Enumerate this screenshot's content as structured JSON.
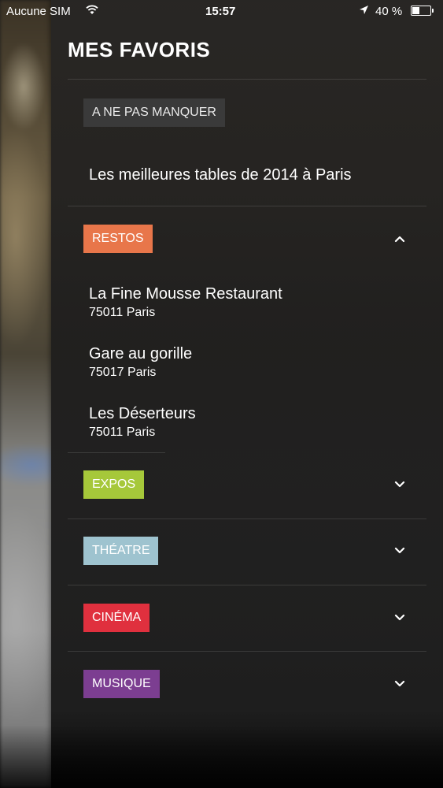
{
  "status_bar": {
    "carrier": "Aucune SIM",
    "time": "15:57",
    "battery": "40 %",
    "battery_level": 0.4,
    "icons": [
      "wifi-icon",
      "location-arrow-icon",
      "battery-icon"
    ]
  },
  "drawer": {
    "title": "MES FAVORIS",
    "sections": [
      {
        "tag": "A NE PAS MANQUER",
        "color": "#3a3a3a",
        "items": [
          {
            "title": "Les meilleures tables de 2014 à Paris"
          }
        ]
      },
      {
        "tag": "RESTOS",
        "color": "#e8764a",
        "expanded": true,
        "chevron": "chevron-up-icon",
        "items": [
          {
            "title": "La Fine Mousse Restaurant",
            "subtitle": "75011 Paris"
          },
          {
            "title": "Gare au gorille",
            "subtitle": "75017 Paris"
          },
          {
            "title": "Les Déserteurs",
            "subtitle": "75011 Paris"
          }
        ]
      },
      {
        "tag": "EXPOS",
        "color": "#a6c83a",
        "expanded": false,
        "chevron": "chevron-down-icon"
      },
      {
        "tag": "THÉATRE",
        "color": "#9ec3cf",
        "expanded": false,
        "chevron": "chevron-down-icon"
      },
      {
        "tag": "CINÉMA",
        "color": "#e0303e",
        "expanded": false,
        "chevron": "chevron-down-icon"
      },
      {
        "tag": "MUSIQUE",
        "color": "#7c3e91",
        "expanded": false,
        "chevron": "chevron-down-icon"
      }
    ]
  }
}
